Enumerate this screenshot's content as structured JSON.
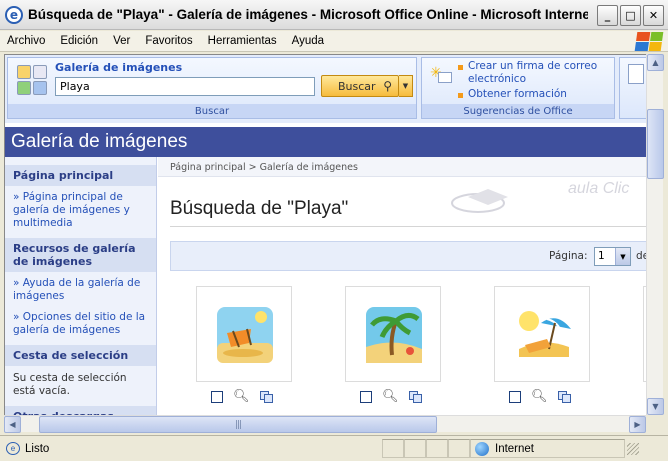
{
  "window": {
    "title": "Búsqueda de \"Playa\" - Galería de imágenes - Microsoft Office Online - Microsoft Internet...",
    "icon": "ie-icon"
  },
  "menu": [
    "Archivo",
    "Edición",
    "Ver",
    "Favoritos",
    "Herramientas",
    "Ayuda"
  ],
  "search_panel": {
    "label": "Galería de imágenes",
    "value": "Playa",
    "button": "Buscar",
    "footer": "Buscar"
  },
  "suggestions": {
    "items": [
      "Crear un firma de correo electrónico",
      "Obtener formación"
    ],
    "footer": "Sugerencias de Office"
  },
  "banner": {
    "title": "Galería de imágenes"
  },
  "sidebar": {
    "home_title": "Página principal",
    "home_link": "» Página principal de galería de imágenes y multimedia",
    "resources_title": "Recursos de galería de imágenes",
    "resources_links": [
      "» Ayuda de la galería de imágenes",
      "» Opciones del sitio de la galería de imágenes"
    ],
    "cart_title": "Cesta de selección",
    "cart_text": "Su cesta de selección está vacía.",
    "downloads_title": "Otras descargas"
  },
  "content": {
    "breadcrumb": "Página principal  >  Galería de imágenes",
    "heading": "Búsqueda de \"Playa\"",
    "page_label": "Página:",
    "page_value": "1",
    "page_of": "de",
    "watermark": "aula Clic"
  },
  "status": {
    "text": "Listo",
    "zone": "Internet"
  },
  "colors": {
    "banner": "#3e4f9c",
    "link": "#2450b8",
    "accent": "#f6bb3d"
  }
}
